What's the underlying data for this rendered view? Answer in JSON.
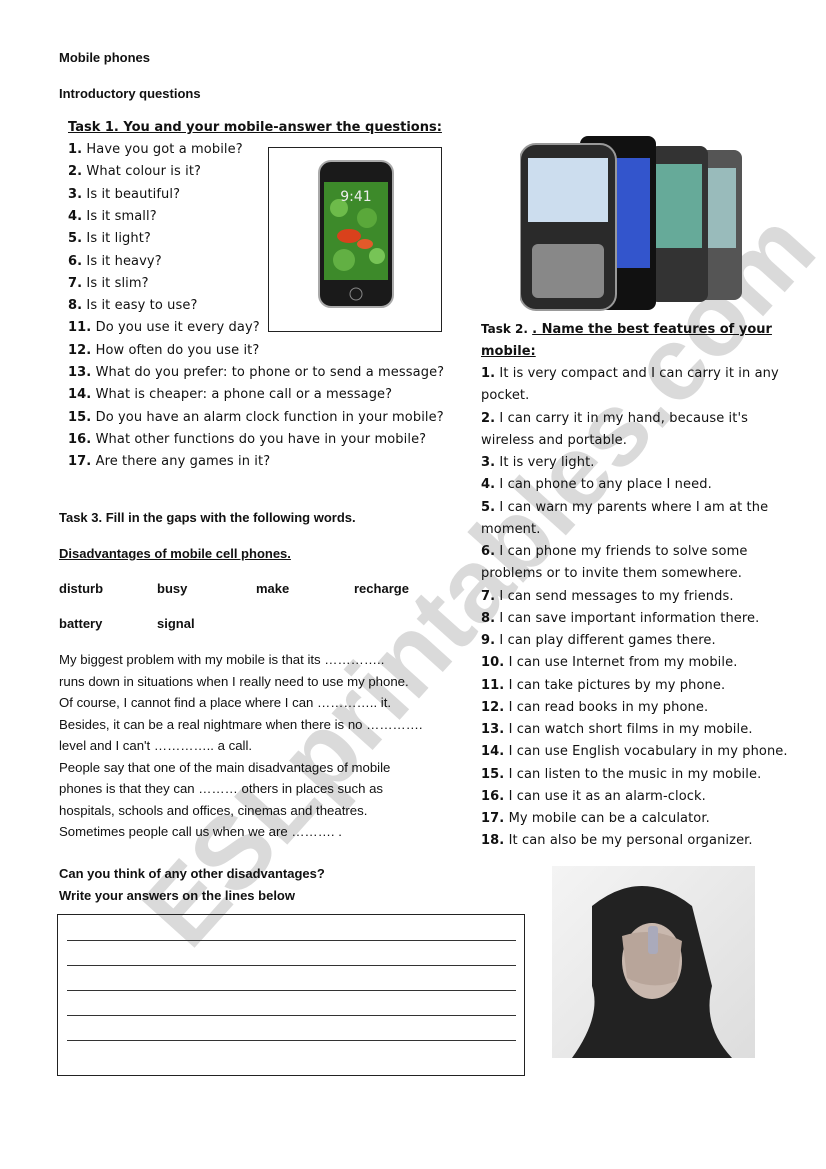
{
  "title": "Mobile phones",
  "subtitle": "Introductory questions",
  "task1": {
    "heading": "Task 1. You and your mobile-answer the questions:",
    "questions": [
      {
        "n": "1.",
        "t": "Have you got a mobile?"
      },
      {
        "n": "2.",
        "t": "What colour is it?"
      },
      {
        "n": "3.",
        "t": "Is it beautiful?"
      },
      {
        "n": "4.",
        "t": "Is it small?"
      },
      {
        "n": "5.",
        "t": "Is it light?"
      },
      {
        "n": "6.",
        "t": "Is it heavy?"
      },
      {
        "n": "7.",
        "t": " Is it slim?"
      },
      {
        "n": "8.",
        "t": "Is it easy to use?"
      },
      {
        "n": "11.",
        "t": "Do you use it every day?"
      },
      {
        "n": "12.",
        "t": "How often do you use it?"
      },
      {
        "n": "13.",
        "t": "What do you prefer: to phone or to send a message?"
      },
      {
        "n": "14.",
        "t": "What is cheaper: a phone call or a message?"
      },
      {
        "n": "15.",
        "t": " Do you have an alarm clock function in your mobile?"
      },
      {
        "n": "16.",
        "t": "What other functions do you have in your mobile?"
      },
      {
        "n": "17.",
        "t": "Are there any games in it?"
      }
    ],
    "phone_screen_time": "9:41"
  },
  "task2": {
    "label": "Task 2. ",
    "heading": ". Name the best features of your",
    "heading2": "mobile:",
    "lines": [
      {
        "n": "1.",
        "t": "It is very compact and I can carry it in any"
      },
      {
        "n": "",
        "t": "pocket."
      },
      {
        "n": "2.",
        "t": "I can carry it in my hand, because it's"
      },
      {
        "n": "",
        "t": "wireless and portable."
      },
      {
        "n": "3.",
        "t": "It is very light."
      },
      {
        "n": "4.",
        "t": "I can phone to any place I need."
      },
      {
        "n": "5.",
        "t": "I can warn my parents where I am at the"
      },
      {
        "n": "",
        "t": "moment."
      },
      {
        "n": "6.",
        "t": "I can phone my friends to solve some"
      },
      {
        "n": "",
        "t": "problems or to invite them somewhere."
      },
      {
        "n": "7.",
        "t": "I can send messages to my friends."
      },
      {
        "n": "8.",
        "t": "I can save important information there."
      },
      {
        "n": "9.",
        "t": " I can play different games there."
      },
      {
        "n": "10.",
        "t": "I can use Internet from my mobile."
      },
      {
        "n": "11.",
        "t": "I can take pictures by my phone."
      },
      {
        "n": "12.",
        "t": "I can read books in my phone."
      },
      {
        "n": "13.",
        "t": "I can watch short films in my mobile."
      },
      {
        "n": "14.",
        "t": "I can use English vocabulary in my phone."
      },
      {
        "n": "15.",
        "t": "I can listen to the music in my mobile."
      },
      {
        "n": "16.",
        "t": "I can use it as an alarm-clock."
      },
      {
        "n": "17.",
        "t": "My mobile can be a calculator."
      },
      {
        "n": "18.",
        "t": "It can also be my personal organizer."
      }
    ]
  },
  "task3": {
    "heading": "Task 3. Fill in the gaps with the following words.",
    "subheading": "Disadvantages of mobile cell phones.",
    "words": [
      "disturb",
      "busy",
      "make",
      "recharge",
      "battery",
      "signal"
    ],
    "paragraph": [
      "My biggest problem with my mobile is that its …………..",
      "runs down in situations when I really need to use my phone.",
      "Of course, I cannot find a place where I can ………….. it.",
      "Besides, it can be a real nightmare when there is no ………….",
      "level and I can't ………….. a call.",
      "People say that one of the main disadvantages of mobile",
      "phones is that they can ……… others in places such as",
      "hospitals, schools and offices, cinemas and theatres.",
      "Sometimes people call us when we are ………. ."
    ],
    "question": "Can you think of any other disadvantages?",
    "instruction": "Write your answers on the lines below",
    "answer_lines": 5
  },
  "watermark": "ESLprintables.com"
}
